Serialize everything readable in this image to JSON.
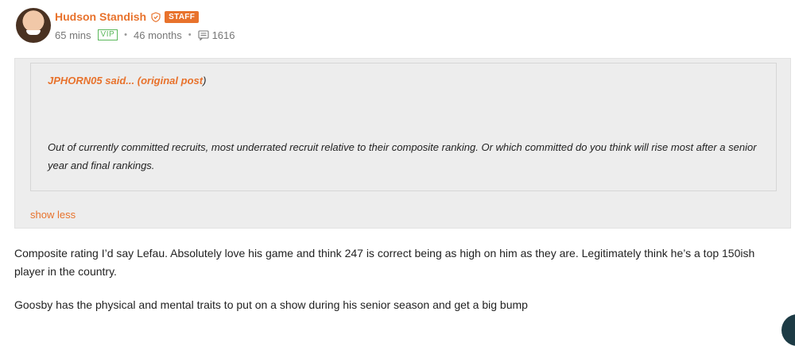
{
  "post": {
    "author": "Hudson Standish",
    "staff_badge": "STAFF",
    "time": "65 mins",
    "vip_badge": "VIP",
    "tenure": "46 months",
    "post_count": "1616"
  },
  "quote": {
    "author": "JPHORN05",
    "said": "said... (",
    "original_post_link": "original post",
    "close_paren": ")",
    "text": "Out of currently committed recruits, most underrated recruit relative to their composite ranking. Or which committed do you think will rise most after a senior year and final rankings.",
    "toggle_label": "show less"
  },
  "body": {
    "paragraphs": [
      "Composite rating I’d say Lefau. Absolutely love his game and think 247 is correct being as high on him as they are. Legitimately think he’s a top 150ish player in the country.",
      "Goosby has the physical and mental traits to put on a show during his senior season and get a big bump"
    ]
  },
  "colors": {
    "accent": "#e8722c",
    "vip": "#5cb85c",
    "quote_bg": "#ededed"
  },
  "icons": {
    "verified": "shield-check-icon",
    "posts": "comment-icon"
  }
}
